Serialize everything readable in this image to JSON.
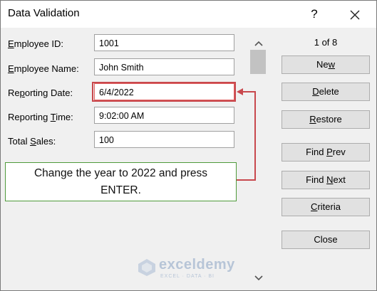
{
  "window": {
    "title": "Data Validation",
    "help_glyph": "?"
  },
  "fields": [
    {
      "label_pre": "",
      "label_key": "E",
      "label_post": "mployee ID:",
      "value": "1001"
    },
    {
      "label_pre": "",
      "label_key": "E",
      "label_post": "mployee Name:",
      "value": "John Smith"
    },
    {
      "label_pre": "Re",
      "label_key": "p",
      "label_post": "orting Date:",
      "value": "6/4/2022"
    },
    {
      "label_pre": "Reporting ",
      "label_key": "T",
      "label_post": "ime:",
      "value": "9:02:00 AM"
    },
    {
      "label_pre": "Total ",
      "label_key": "S",
      "label_post": "ales:",
      "value": "100"
    }
  ],
  "record_count": "1 of 8",
  "buttons": {
    "new": {
      "pre": "Ne",
      "key": "w",
      "post": ""
    },
    "delete": {
      "pre": "",
      "key": "D",
      "post": "elete"
    },
    "restore": {
      "pre": "",
      "key": "R",
      "post": "estore"
    },
    "find_prev": {
      "pre": "Find ",
      "key": "P",
      "post": "rev"
    },
    "find_next": {
      "pre": "Find ",
      "key": "N",
      "post": "ext"
    },
    "criteria": {
      "pre": "",
      "key": "C",
      "post": "riteria"
    },
    "close": {
      "pre": "",
      "key": "",
      "post": "Close"
    }
  },
  "callout": {
    "line1": "Change the year to 2022 and press",
    "line2": "ENTER."
  },
  "watermark": {
    "name": "exceldemy",
    "tagline": "EXCEL · DATA · BI"
  },
  "icons": {
    "close": "close-icon",
    "scroll_up": "chevron-up-icon",
    "scroll_down": "chevron-down-icon",
    "logo": "exceldemy-logo-icon"
  },
  "colors": {
    "highlight": "#c8484d",
    "callout_border": "#4e9a3a",
    "button_face": "#e1e1e1"
  }
}
